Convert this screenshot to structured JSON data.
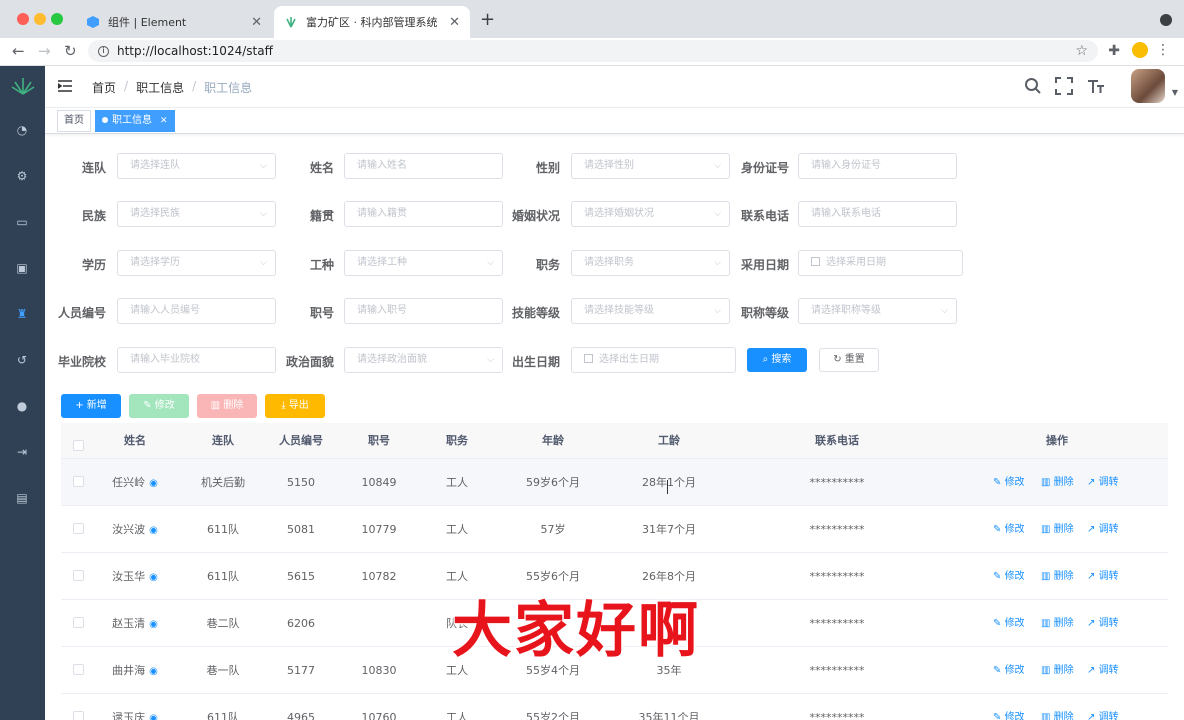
{
  "browser": {
    "tabs": [
      {
        "title": "组件 | Element"
      },
      {
        "title": "富力矿区 · 科内部管理系统"
      }
    ],
    "url": "http://localhost:1024/staff"
  },
  "header": {
    "breadcrumb": [
      "首页",
      "职工信息",
      "职工信息"
    ]
  },
  "tags": [
    "首页",
    "职工信息"
  ],
  "filters": [
    {
      "label": "连队",
      "placeholder": "请选择连队",
      "type": "select"
    },
    {
      "label": "姓名",
      "placeholder": "请输入姓名",
      "type": "input"
    },
    {
      "label": "性别",
      "placeholder": "请选择性别",
      "type": "select"
    },
    {
      "label": "身份证号",
      "placeholder": "请输入身份证号",
      "type": "input"
    },
    {
      "label": "民族",
      "placeholder": "请选择民族",
      "type": "select"
    },
    {
      "label": "籍贯",
      "placeholder": "请输入籍贯",
      "type": "input"
    },
    {
      "label": "婚姻状况",
      "placeholder": "请选择婚姻状况",
      "type": "select"
    },
    {
      "label": "联系电话",
      "placeholder": "请输入联系电话",
      "type": "input"
    },
    {
      "label": "学历",
      "placeholder": "请选择学历",
      "type": "select"
    },
    {
      "label": "工种",
      "placeholder": "请选择工种",
      "type": "select"
    },
    {
      "label": "职务",
      "placeholder": "请选择职务",
      "type": "select"
    },
    {
      "label": "采用日期",
      "placeholder": "选择采用日期",
      "type": "date"
    },
    {
      "label": "人员编号",
      "placeholder": "请输入人员编号",
      "type": "input"
    },
    {
      "label": "职号",
      "placeholder": "请输入职号",
      "type": "input"
    },
    {
      "label": "技能等级",
      "placeholder": "请选择技能等级",
      "type": "select"
    },
    {
      "label": "职称等级",
      "placeholder": "请选择职称等级",
      "type": "select"
    },
    {
      "label": "毕业院校",
      "placeholder": "请输入毕业院校",
      "type": "input"
    },
    {
      "label": "政治面貌",
      "placeholder": "请选择政治面貌",
      "type": "select"
    },
    {
      "label": "出生日期",
      "placeholder": "选择出生日期",
      "type": "date"
    }
  ],
  "buttons": {
    "search": "搜索",
    "reset": "重置",
    "add": "新增",
    "edit": "修改",
    "delete": "删除",
    "export": "导出"
  },
  "table": {
    "columns": [
      "姓名",
      "连队",
      "人员编号",
      "职号",
      "职务",
      "年龄",
      "工龄",
      "联系电话",
      "操作"
    ],
    "ops": [
      "修改",
      "删除",
      "调转"
    ],
    "rows": [
      [
        "任兴岭",
        "机关后勤",
        "5150",
        "10849",
        "工人",
        "59岁6个月",
        "28年1个月",
        "**********"
      ],
      [
        "汝兴波",
        "611队",
        "5081",
        "10779",
        "工人",
        "57岁",
        "31年7个月",
        "**********"
      ],
      [
        "汝玉华",
        "611队",
        "5615",
        "10782",
        "工人",
        "55岁6个月",
        "26年8个月",
        "**********"
      ],
      [
        "赵玉清",
        "巷二队",
        "6206",
        "",
        "队长",
        "",
        "",
        "**********"
      ],
      [
        "曲井海",
        "巷一队",
        "5177",
        "10830",
        "工人",
        "55岁4个月",
        "35年",
        "**********"
      ],
      [
        "逯玉庆",
        "611队",
        "4965",
        "10760",
        "工人",
        "55岁2个月",
        "35年11个月",
        "**********"
      ]
    ]
  },
  "caption": "大家好啊"
}
